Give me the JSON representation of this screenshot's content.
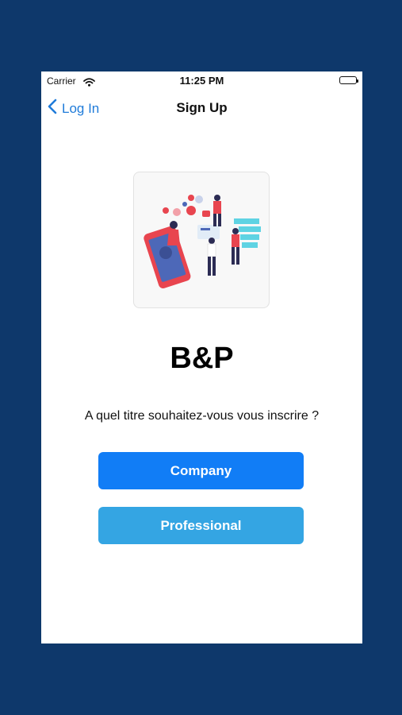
{
  "status_bar": {
    "carrier": "Carrier",
    "time": "11:25 PM"
  },
  "nav": {
    "back_label": "Log In",
    "title": "Sign Up"
  },
  "brand": {
    "name": "B&P"
  },
  "question": "A quel titre souhaitez-vous vous inscrire ?",
  "buttons": {
    "company": "Company",
    "professional": "Professional"
  },
  "colors": {
    "background": "#0e386b",
    "primary_button": "#117df6",
    "secondary_button": "#34a5e3",
    "link": "#1f7bd9"
  }
}
